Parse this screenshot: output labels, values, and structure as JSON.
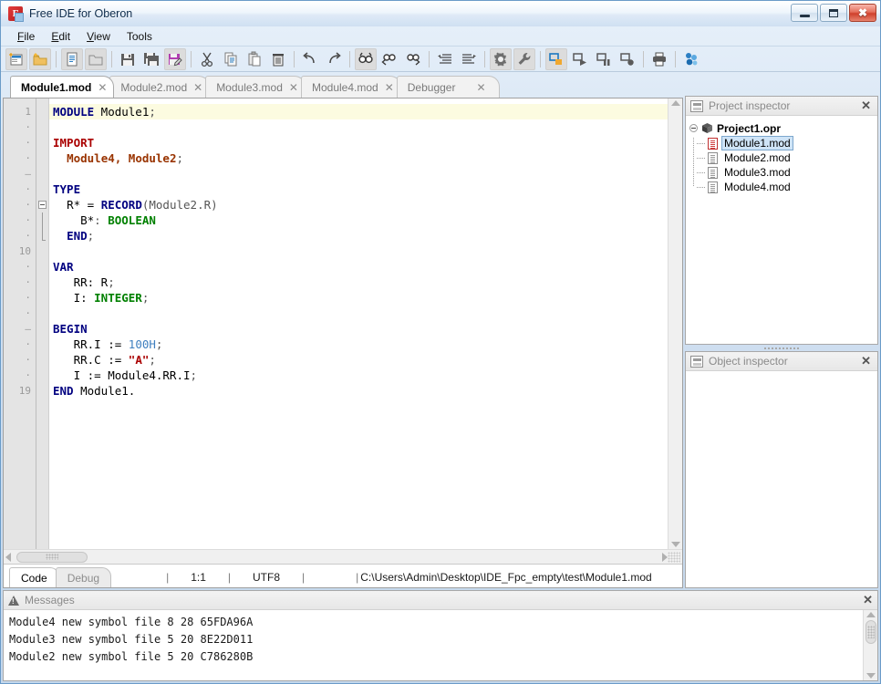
{
  "window": {
    "title": "Free IDE for Oberon",
    "app_icon": "fpc-icon",
    "controls": {
      "minimize": "minimize",
      "maximize": "maximize",
      "close": "close"
    }
  },
  "menubar": {
    "items": [
      {
        "label": "File",
        "mnemonic": "F"
      },
      {
        "label": "Edit",
        "mnemonic": "E"
      },
      {
        "label": "View",
        "mnemonic": "V"
      },
      {
        "label": "Tools",
        "mnemonic": "T"
      }
    ]
  },
  "toolbar": {
    "groups": [
      {
        "buttons": [
          {
            "name": "new-project-icon",
            "framed": true
          },
          {
            "name": "open-project-icon",
            "framed": true
          }
        ]
      },
      {
        "buttons": [
          {
            "name": "new-file-icon",
            "framed": true
          },
          {
            "name": "open-file-icon",
            "framed": true
          }
        ]
      },
      {
        "buttons": [
          {
            "name": "save-icon",
            "framed": false
          },
          {
            "name": "save-all-icon",
            "framed": false
          },
          {
            "name": "save-as-icon",
            "framed": true
          }
        ]
      },
      {
        "buttons": [
          {
            "name": "cut-icon",
            "framed": false
          },
          {
            "name": "copy-icon",
            "framed": false
          },
          {
            "name": "paste-icon",
            "framed": false
          },
          {
            "name": "delete-icon",
            "framed": false
          }
        ]
      },
      {
        "buttons": [
          {
            "name": "undo-icon",
            "framed": false
          },
          {
            "name": "redo-icon",
            "framed": false
          }
        ]
      },
      {
        "buttons": [
          {
            "name": "find-icon",
            "framed": true
          },
          {
            "name": "find-previous-icon",
            "framed": false
          },
          {
            "name": "find-next-icon",
            "framed": false
          }
        ]
      },
      {
        "buttons": [
          {
            "name": "unindent-icon",
            "framed": false
          },
          {
            "name": "indent-icon",
            "framed": false
          }
        ]
      },
      {
        "buttons": [
          {
            "name": "settings-gear-icon",
            "framed": true
          },
          {
            "name": "tools-wrench-icon",
            "framed": true
          }
        ]
      },
      {
        "buttons": [
          {
            "name": "build-icon",
            "framed": true
          },
          {
            "name": "run-icon",
            "framed": false
          },
          {
            "name": "pause-icon",
            "framed": false
          },
          {
            "name": "stop-icon",
            "framed": false
          }
        ]
      },
      {
        "buttons": [
          {
            "name": "print-icon",
            "framed": false
          }
        ]
      },
      {
        "buttons": [
          {
            "name": "about-icon",
            "framed": false
          }
        ]
      }
    ]
  },
  "editor_tabs": [
    {
      "label": "Module1.mod",
      "active": true,
      "close": "✕"
    },
    {
      "label": "Module2.mod",
      "active": false,
      "close": "✕"
    },
    {
      "label": "Module3.mod",
      "active": false,
      "close": "✕"
    },
    {
      "label": "Module4.mod",
      "active": false,
      "close": "✕"
    },
    {
      "label": "Debugger",
      "active": false,
      "close": "✕"
    }
  ],
  "editor": {
    "gutter": [
      "1",
      "·",
      "·",
      "·",
      "–",
      "·",
      "·",
      "·",
      "·",
      "10",
      "·",
      "·",
      "·",
      "·",
      "–",
      "·",
      "·",
      "·",
      "19"
    ],
    "total_lines": 19,
    "current_line": 1,
    "lines": [
      {
        "n": 1,
        "current": true,
        "tokens": [
          {
            "t": "MODULE",
            "c": "kw"
          },
          {
            "t": " Module1",
            "c": "pln"
          },
          {
            "t": ";",
            "c": "punc"
          }
        ]
      },
      {
        "n": 2,
        "current": false,
        "tokens": []
      },
      {
        "n": 3,
        "current": false,
        "tokens": [
          {
            "t": "IMPORT",
            "c": "kwr"
          }
        ]
      },
      {
        "n": 4,
        "current": false,
        "tokens": [
          {
            "t": "  ",
            "c": "pln"
          },
          {
            "t": "Module4, Module2",
            "c": "mod"
          },
          {
            "t": ";",
            "c": "punc"
          }
        ]
      },
      {
        "n": 5,
        "current": false,
        "tokens": []
      },
      {
        "n": 6,
        "current": false,
        "tokens": [
          {
            "t": "TYPE",
            "c": "kw"
          }
        ]
      },
      {
        "n": 7,
        "current": false,
        "tokens": [
          {
            "t": "  ",
            "c": "pln"
          },
          {
            "t": "R*",
            "c": "pln"
          },
          {
            "t": " = ",
            "c": "pln"
          },
          {
            "t": "RECORD",
            "c": "kw"
          },
          {
            "t": "(Module2.R)",
            "c": "punc"
          }
        ]
      },
      {
        "n": 8,
        "current": false,
        "tokens": [
          {
            "t": "    ",
            "c": "pln"
          },
          {
            "t": "B*",
            "c": "pln"
          },
          {
            "t": ": ",
            "c": "punc"
          },
          {
            "t": "BOOLEAN",
            "c": "typ"
          }
        ]
      },
      {
        "n": 9,
        "current": false,
        "tokens": [
          {
            "t": "  ",
            "c": "pln"
          },
          {
            "t": "END",
            "c": "kw"
          },
          {
            "t": ";",
            "c": "punc"
          }
        ]
      },
      {
        "n": 10,
        "current": false,
        "tokens": []
      },
      {
        "n": 11,
        "current": false,
        "tokens": [
          {
            "t": "VAR",
            "c": "kw"
          }
        ]
      },
      {
        "n": 12,
        "current": false,
        "tokens": [
          {
            "t": "   RR: R",
            "c": "pln"
          },
          {
            "t": ";",
            "c": "punc"
          }
        ]
      },
      {
        "n": 13,
        "current": false,
        "tokens": [
          {
            "t": "   I: ",
            "c": "pln"
          },
          {
            "t": "INTEGER",
            "c": "typ"
          },
          {
            "t": ";",
            "c": "punc"
          }
        ]
      },
      {
        "n": 14,
        "current": false,
        "tokens": []
      },
      {
        "n": 15,
        "current": false,
        "tokens": [
          {
            "t": "BEGIN",
            "c": "kw"
          }
        ]
      },
      {
        "n": 16,
        "current": false,
        "tokens": [
          {
            "t": "   RR.I := ",
            "c": "pln"
          },
          {
            "t": "100H",
            "c": "num"
          },
          {
            "t": ";",
            "c": "punc"
          }
        ]
      },
      {
        "n": 17,
        "current": false,
        "tokens": [
          {
            "t": "   RR.C := ",
            "c": "pln"
          },
          {
            "t": "\"A\"",
            "c": "str"
          },
          {
            "t": ";",
            "c": "punc"
          }
        ]
      },
      {
        "n": 18,
        "current": false,
        "tokens": [
          {
            "t": "   I := Module4.RR.I",
            "c": "pln"
          },
          {
            "t": ";",
            "c": "punc"
          }
        ]
      },
      {
        "n": 19,
        "current": false,
        "tokens": [
          {
            "t": "END",
            "c": "kw"
          },
          {
            "t": " Module1.",
            "c": "pln"
          }
        ]
      }
    ]
  },
  "statusbar": {
    "tabs": [
      {
        "label": "Code",
        "active": true
      },
      {
        "label": "Debug",
        "active": false
      }
    ],
    "separator": "|",
    "caret_position": "1:1",
    "encoding": "UTF8",
    "file_path": "C:\\Users\\Admin\\Desktop\\IDE_Fpc_empty\\test\\Module1.mod"
  },
  "project_inspector": {
    "title": "Project inspector",
    "icon": "project-inspector-icon",
    "close": "✕",
    "root": {
      "label": "Project1.opr",
      "icon": "package-icon",
      "expanded": true
    },
    "nodes": [
      {
        "label": "Module1.mod",
        "icon": "document-icon-red",
        "selected": true
      },
      {
        "label": "Module2.mod",
        "icon": "document-icon",
        "selected": false
      },
      {
        "label": "Module3.mod",
        "icon": "document-icon",
        "selected": false
      },
      {
        "label": "Module4.mod",
        "icon": "document-icon",
        "selected": false
      }
    ]
  },
  "object_inspector": {
    "title": "Object inspector",
    "icon": "object-inspector-icon",
    "close": "✕"
  },
  "messages": {
    "title": "Messages",
    "icon": "warning-icon",
    "close": "✕",
    "lines": [
      "Module4 new symbol file 8 28 65FDA96A",
      "Module3 new symbol file 5 20 8E22D011",
      "Module2 new symbol file 5 20 C786280B"
    ]
  },
  "colors": {
    "keyword": "#000080",
    "keyword_red": "#aa0000",
    "module": "#993300",
    "type": "#008000",
    "number": "#3f7fbf",
    "string": "#aa0000",
    "current_line": "#fcfbe0",
    "selection": "#cfe4f7",
    "window_frame": "#6a9bc8"
  }
}
